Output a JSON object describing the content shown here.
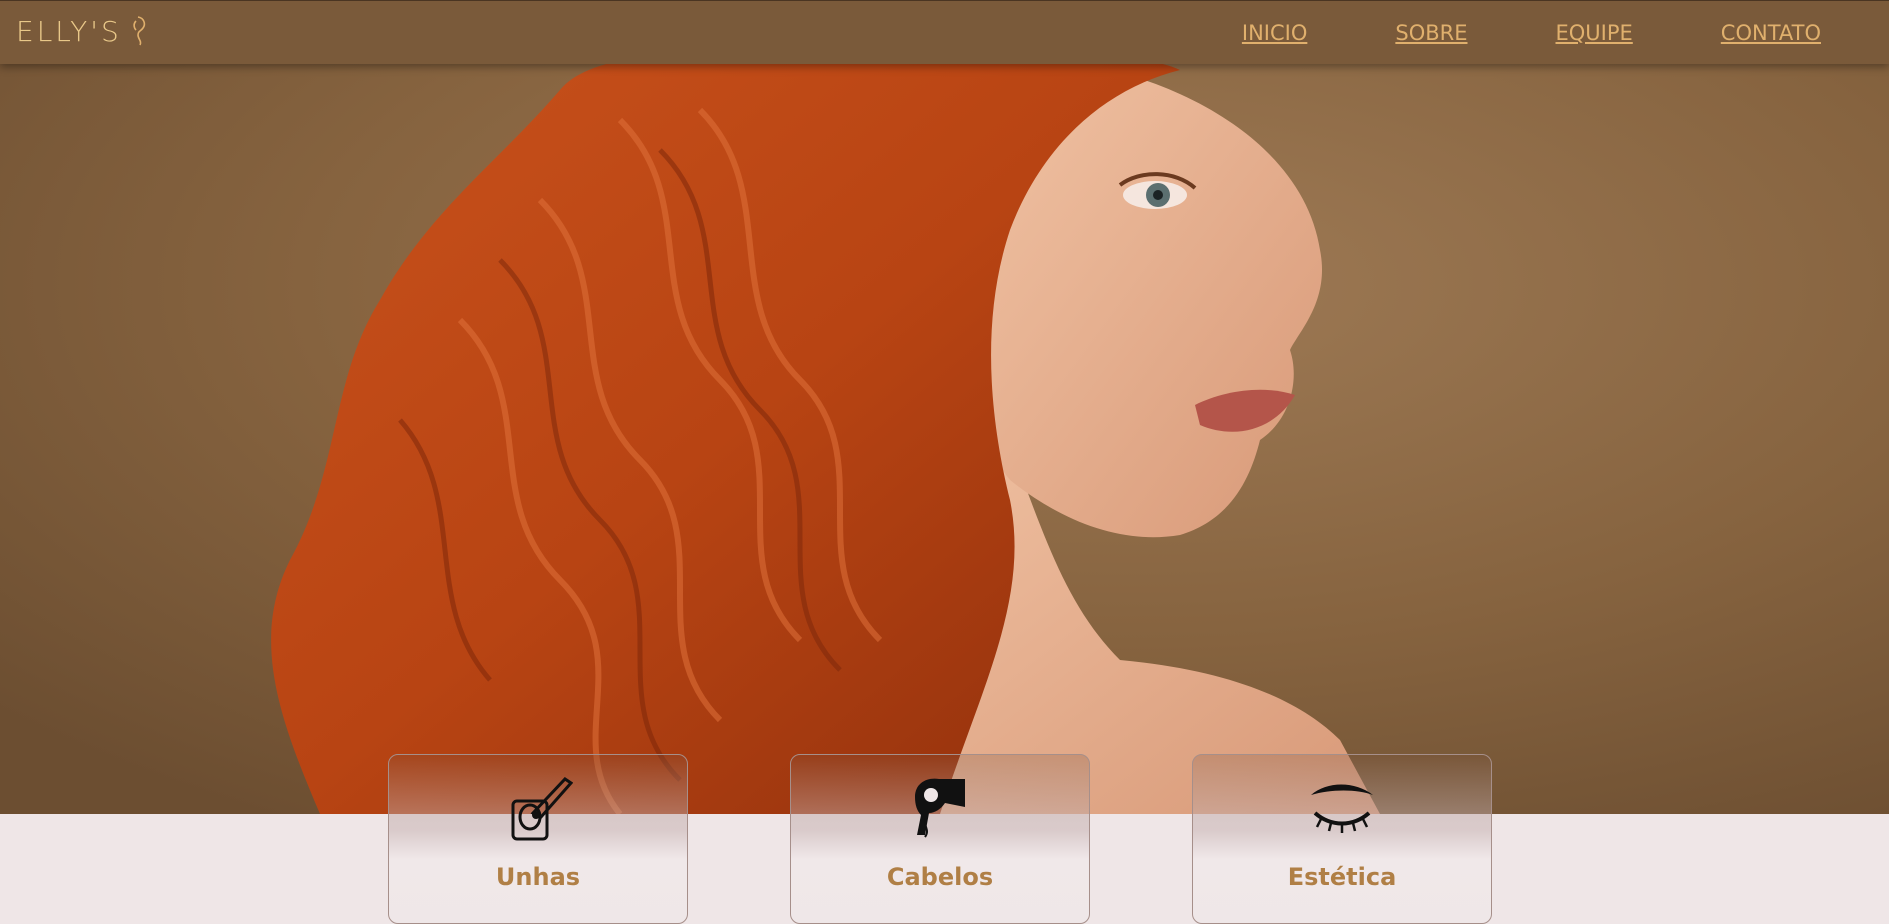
{
  "header": {
    "logo_text": "ELLY'S",
    "nav": [
      {
        "label": "INICIO"
      },
      {
        "label": "SOBRE"
      },
      {
        "label": "EQUIPE"
      },
      {
        "label": "CONTATO"
      }
    ]
  },
  "hero": {
    "image_alt": "Mulher de perfil com cabelo ruivo ondulado"
  },
  "services": [
    {
      "label": "Unhas",
      "icon": "nail-polish-icon"
    },
    {
      "label": "Cabelos",
      "icon": "hair-dryer-icon"
    },
    {
      "label": "Estética",
      "icon": "eyelash-icon"
    }
  ],
  "colors": {
    "header_bg": "#7a5a3a",
    "nav_link": "#e0b06d",
    "accent_label": "#b07f45",
    "page_bg": "#efe6e7"
  }
}
